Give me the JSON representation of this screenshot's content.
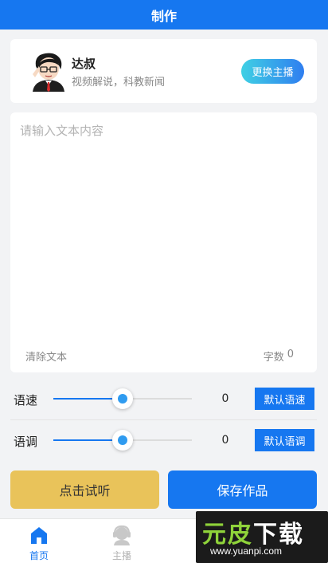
{
  "header": {
    "title": "制作"
  },
  "anchor": {
    "name": "达叔",
    "description": "视频解说，科教新闻",
    "switch_label": "更换主播",
    "avatar_icon": "cartoon-man-avatar"
  },
  "editor": {
    "placeholder": "请输入文本内容",
    "value": "",
    "clear_label": "清除文本",
    "count_label": "字数",
    "count_value": "0"
  },
  "controls": {
    "speed": {
      "label": "语速",
      "value": "0",
      "level": 0.5,
      "default_label": "默认语速"
    },
    "pitch": {
      "label": "语调",
      "value": "0",
      "level": 0.5,
      "default_label": "默认语调"
    }
  },
  "actions": {
    "listen_label": "点击试听",
    "save_label": "保存作品"
  },
  "tabbar": {
    "items": [
      {
        "label": "首页",
        "icon": "home-icon",
        "active": true
      },
      {
        "label": "主播",
        "icon": "anchor-headset-icon",
        "active": false
      }
    ]
  },
  "watermark": {
    "title_part1": "元皮",
    "title_part2": "下载",
    "url": "www.yuanpi.com"
  },
  "colors": {
    "primary": "#1677f0",
    "listen_button": "#e9c35a",
    "background": "#f2f3f5"
  }
}
